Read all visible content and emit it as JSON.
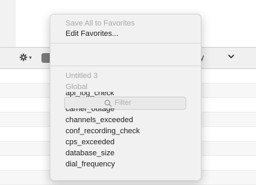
{
  "toolbar": {
    "category_text": "ory"
  },
  "menu": {
    "save_all": "Save All to Favorites",
    "edit_favorites": "Edit Favorites...",
    "group_untitled": "Untitled 3",
    "group_global": "Global",
    "filter_placeholder": "Filter",
    "partial_item_1": "api_log_check",
    "partial_item_2": "carrier_outage",
    "items": [
      "channels_exceeded",
      "conf_recording_check",
      "cps_exceeded",
      "database_size",
      "dial_frequency"
    ]
  },
  "icons": {
    "gear": "gear-icon",
    "chevron": "chevron-down-icon",
    "search": "search-icon"
  }
}
